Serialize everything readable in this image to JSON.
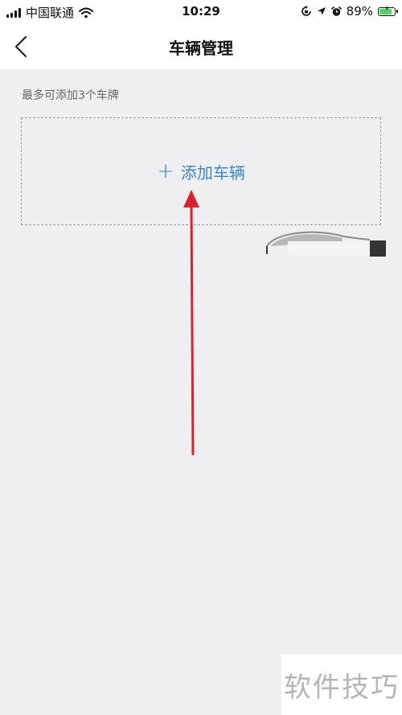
{
  "status_bar": {
    "carrier": "中国联通",
    "time": "10:29",
    "battery_percent": "89%",
    "battery_level": 0.89,
    "icons": [
      "signal-icon",
      "wifi-icon",
      "rotation-lock-icon",
      "location-icon",
      "alarm-icon",
      "battery-icon"
    ]
  },
  "nav": {
    "title": "车辆管理",
    "back_icon": "chevron-left-icon"
  },
  "content": {
    "hint": "最多可添加3个车牌",
    "add_button": {
      "icon": "plus-icon",
      "label": "添加车辆"
    }
  },
  "watermark": {
    "text": "软件技巧"
  },
  "colors": {
    "accent": "#3a86c8",
    "background": "#efeff1",
    "annotation_arrow": "#d9232e"
  }
}
